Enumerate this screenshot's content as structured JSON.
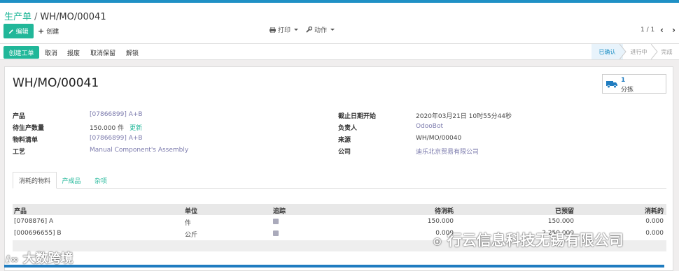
{
  "breadcrumb": {
    "parent": "生产单",
    "separator": "/",
    "current": "WH/MO/00041"
  },
  "toolbar": {
    "edit": "编辑",
    "create": "创建",
    "print": "打印",
    "action": "动作",
    "pager": "1 / 1"
  },
  "statusbar": {
    "buttons": [
      "创建工单",
      "取消",
      "报废",
      "取消保留",
      "解锁"
    ],
    "stages": [
      "已确认",
      "进行中",
      "完成"
    ]
  },
  "record": {
    "title": "WH/MO/00041",
    "smart_button": {
      "count": "1",
      "label": "分拣"
    },
    "left_fields": [
      {
        "label": "产品",
        "value": "[07866899] A+B"
      },
      {
        "label": "待生产数量",
        "value": "150.000 件",
        "extra": "更新"
      },
      {
        "label": "物料清单",
        "value": "[07866899] A+B"
      },
      {
        "label": "工艺",
        "value": "Manual Component's Assembly"
      }
    ],
    "right_fields": [
      {
        "label": "截止日期开始",
        "value": "2020年03月21日 10时55分44秒"
      },
      {
        "label": "负责人",
        "value": "OdooBot"
      },
      {
        "label": "来源",
        "value": "WH/MO/00040"
      },
      {
        "label": "公司",
        "value": "迪乐北京贸易有限公司"
      }
    ]
  },
  "tabs": [
    "消耗的物料",
    "产成品",
    "杂项"
  ],
  "table": {
    "headers": [
      "产品",
      "单位",
      "追踪",
      "待消耗",
      "已预留",
      "消耗的"
    ],
    "rows": [
      {
        "product": "[0708876] A",
        "unit": "件",
        "to_consume": "150.000",
        "reserved": "150.000",
        "consumed": "0.000"
      },
      {
        "product": "[000696655] B",
        "unit": "公斤",
        "to_consume": "0.000",
        "reserved": "2,250.000",
        "consumed": "0.000"
      }
    ]
  },
  "watermarks": {
    "left": "大数跨境",
    "right": "行云信息科技无锡有限公司"
  },
  "colors": {
    "primary": "#21b799",
    "topbar": "#1f90c5",
    "link": "#7c7bad"
  }
}
